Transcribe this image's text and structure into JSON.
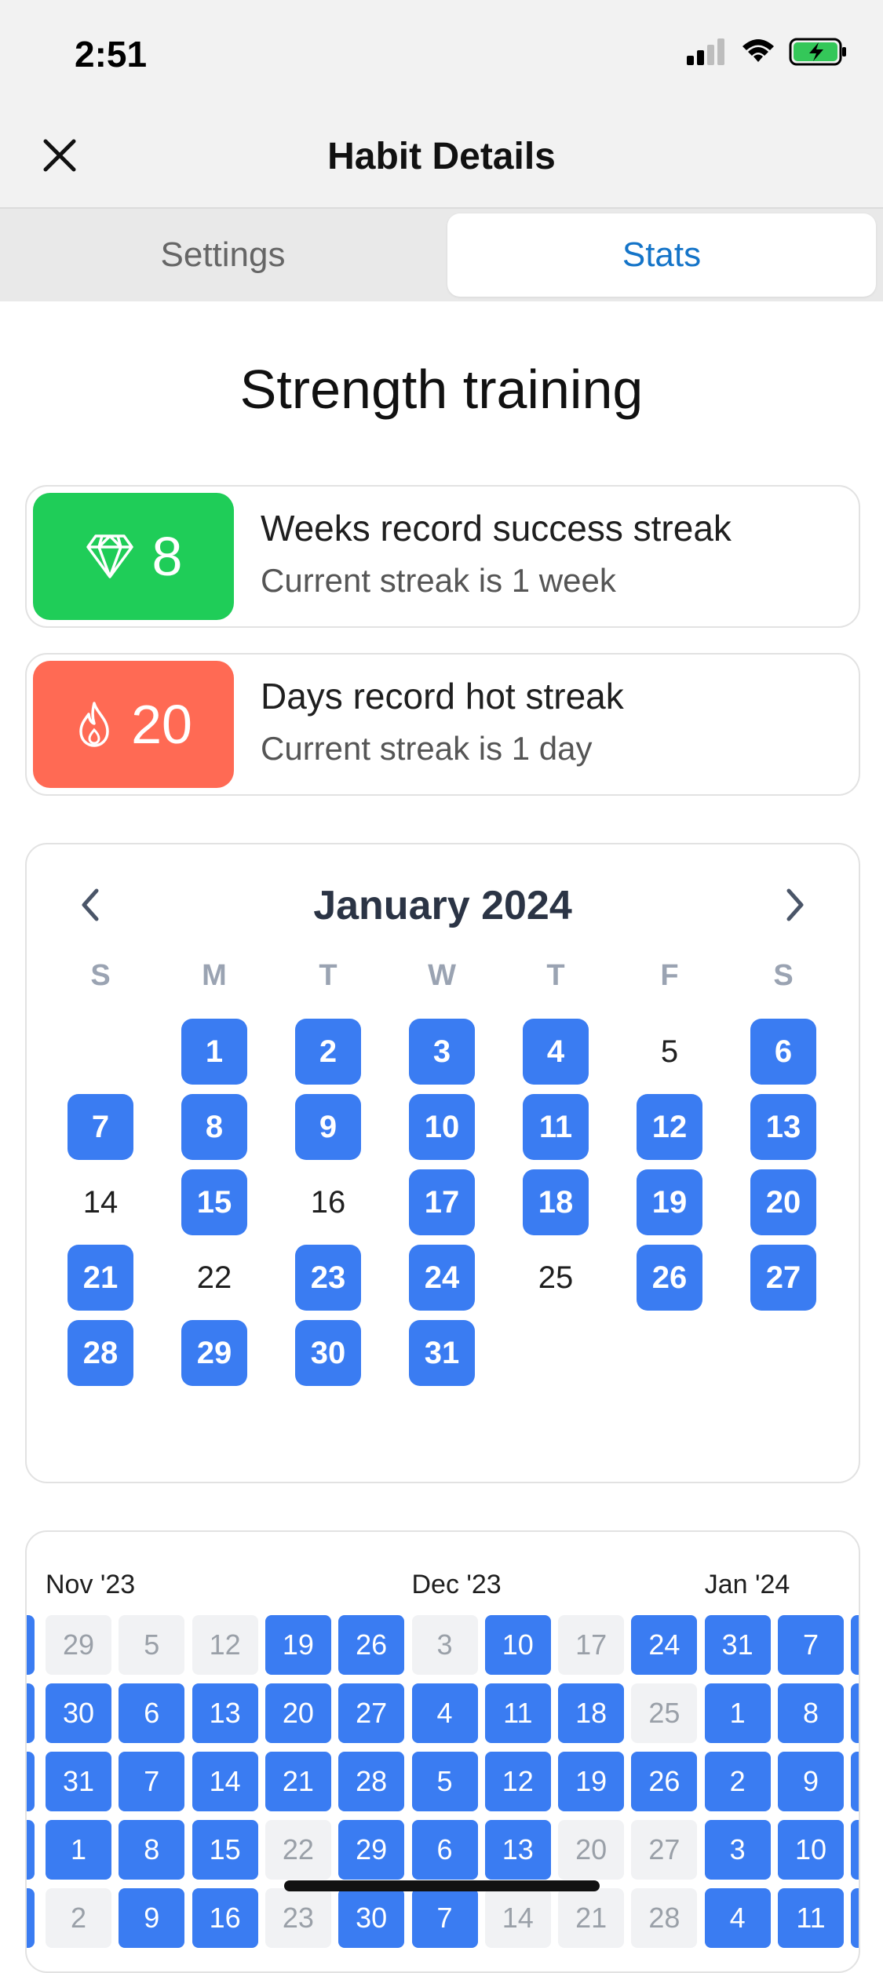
{
  "status": {
    "time": "2:51"
  },
  "nav": {
    "title": "Habit Details"
  },
  "tabs": {
    "settings": "Settings",
    "stats": "Stats",
    "active": "Stats"
  },
  "habit": {
    "name": "Strength training"
  },
  "colors": {
    "accent": "#3a7cf2",
    "success": "#1fcd58",
    "hot": "#ff6a54",
    "tab_active": "#1474c8"
  },
  "streaks": [
    {
      "icon": "diamond-icon",
      "value": "8",
      "title": "Weeks record success streak",
      "subtitle": "Current streak is 1 week"
    },
    {
      "icon": "flame-icon",
      "value": "20",
      "title": "Days record hot streak",
      "subtitle": "Current streak is 1 day"
    }
  ],
  "calendar": {
    "month_label": "January 2024",
    "weekdays": [
      "S",
      "M",
      "T",
      "W",
      "T",
      "F",
      "S"
    ],
    "start_weekday": 1,
    "days": [
      {
        "d": "1",
        "done": true
      },
      {
        "d": "2",
        "done": true
      },
      {
        "d": "3",
        "done": true
      },
      {
        "d": "4",
        "done": true
      },
      {
        "d": "5",
        "done": false
      },
      {
        "d": "6",
        "done": true
      },
      {
        "d": "7",
        "done": true
      },
      {
        "d": "8",
        "done": true
      },
      {
        "d": "9",
        "done": true
      },
      {
        "d": "10",
        "done": true
      },
      {
        "d": "11",
        "done": true
      },
      {
        "d": "12",
        "done": true
      },
      {
        "d": "13",
        "done": true
      },
      {
        "d": "14",
        "done": false
      },
      {
        "d": "15",
        "done": true
      },
      {
        "d": "16",
        "done": false
      },
      {
        "d": "17",
        "done": true
      },
      {
        "d": "18",
        "done": true
      },
      {
        "d": "19",
        "done": true
      },
      {
        "d": "20",
        "done": true
      },
      {
        "d": "21",
        "done": true
      },
      {
        "d": "22",
        "done": false
      },
      {
        "d": "23",
        "done": true
      },
      {
        "d": "24",
        "done": true
      },
      {
        "d": "25",
        "done": false
      },
      {
        "d": "26",
        "done": true
      },
      {
        "d": "27",
        "done": true
      },
      {
        "d": "28",
        "done": true
      },
      {
        "d": "29",
        "done": true
      },
      {
        "d": "30",
        "done": true
      },
      {
        "d": "31",
        "done": true
      }
    ]
  },
  "heatmap": {
    "months": [
      {
        "label": "Nov '23",
        "col": 0
      },
      {
        "label": "Dec '23",
        "col": 5
      },
      {
        "label": "Jan '24",
        "col": 9
      }
    ],
    "rows": [
      [
        {
          "d": "29",
          "done": false
        },
        {
          "d": "5",
          "done": false
        },
        {
          "d": "12",
          "done": false
        },
        {
          "d": "19",
          "done": true
        },
        {
          "d": "26",
          "done": true
        },
        {
          "d": "3",
          "done": false
        },
        {
          "d": "10",
          "done": true
        },
        {
          "d": "17",
          "done": false
        },
        {
          "d": "24",
          "done": true
        },
        {
          "d": "31",
          "done": true
        },
        {
          "d": "7",
          "done": true
        }
      ],
      [
        {
          "d": "30",
          "done": true
        },
        {
          "d": "6",
          "done": true
        },
        {
          "d": "13",
          "done": true
        },
        {
          "d": "20",
          "done": true
        },
        {
          "d": "27",
          "done": true
        },
        {
          "d": "4",
          "done": true
        },
        {
          "d": "11",
          "done": true
        },
        {
          "d": "18",
          "done": true
        },
        {
          "d": "25",
          "done": false
        },
        {
          "d": "1",
          "done": true
        },
        {
          "d": "8",
          "done": true
        }
      ],
      [
        {
          "d": "31",
          "done": true
        },
        {
          "d": "7",
          "done": true
        },
        {
          "d": "14",
          "done": true
        },
        {
          "d": "21",
          "done": true
        },
        {
          "d": "28",
          "done": true
        },
        {
          "d": "5",
          "done": true
        },
        {
          "d": "12",
          "done": true
        },
        {
          "d": "19",
          "done": true
        },
        {
          "d": "26",
          "done": true
        },
        {
          "d": "2",
          "done": true
        },
        {
          "d": "9",
          "done": true
        }
      ],
      [
        {
          "d": "1",
          "done": true
        },
        {
          "d": "8",
          "done": true
        },
        {
          "d": "15",
          "done": true
        },
        {
          "d": "22",
          "done": false
        },
        {
          "d": "29",
          "done": true
        },
        {
          "d": "6",
          "done": true
        },
        {
          "d": "13",
          "done": true
        },
        {
          "d": "20",
          "done": false
        },
        {
          "d": "27",
          "done": false
        },
        {
          "d": "3",
          "done": true
        },
        {
          "d": "10",
          "done": true
        }
      ],
      [
        {
          "d": "2",
          "done": false
        },
        {
          "d": "9",
          "done": true
        },
        {
          "d": "16",
          "done": true
        },
        {
          "d": "23",
          "done": false
        },
        {
          "d": "30",
          "done": true
        },
        {
          "d": "7",
          "done": true
        },
        {
          "d": "14",
          "done": false
        },
        {
          "d": "21",
          "done": false
        },
        {
          "d": "28",
          "done": false
        },
        {
          "d": "4",
          "done": true
        },
        {
          "d": "11",
          "done": true
        }
      ]
    ]
  }
}
